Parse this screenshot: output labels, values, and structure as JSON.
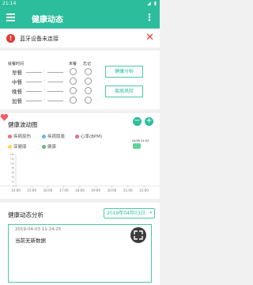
{
  "status_bar": {
    "time": "21:14",
    "icons_text": "◢ ▮"
  },
  "app_bar": {
    "title": "健康动态",
    "more": "⋮"
  },
  "alert": {
    "text": "蓝牙设备未连接",
    "close": "✕"
  },
  "meals": {
    "headers": {
      "time": "就餐时间",
      "skipped": "未餐",
      "forgot": "忘记"
    },
    "rows": [
      {
        "label": "早餐",
        "dash": "-"
      },
      {
        "label": "中餐",
        "dash": "-"
      },
      {
        "label": "晚餐",
        "dash": "-"
      },
      {
        "label": "加餐",
        "dash": "-"
      }
    ],
    "buttons": {
      "analysis": "健康分析",
      "risk": "疾病风险"
    }
  },
  "wave": {
    "title": "健康波动图",
    "zoom_out": "−",
    "zoom_in": "+",
    "legend": [
      {
        "label": "疾病捉伤",
        "color": "#e57373"
      },
      {
        "label": "疾病隐患",
        "color": "#64b5f6"
      },
      {
        "label": "心率(BPM)",
        "color": "#f06292"
      },
      {
        "label": "亚健康",
        "color": "#ffd54f"
      },
      {
        "label": "健康",
        "color": "#66bb6a"
      }
    ],
    "marker_stamp": "04/09 21:03"
  },
  "chart_data": {
    "type": "line",
    "x": [
      "14:00",
      "15:00",
      "16:00",
      "17:00",
      "18:00",
      "19:00",
      "20:00",
      "21:00",
      "22:00"
    ],
    "y_ticks": [
      "140",
      "120",
      "100",
      "80",
      "60",
      "40",
      "20",
      "0"
    ],
    "series": []
  },
  "analysis": {
    "title": "健康动态分析",
    "date": "2019年04月03日",
    "date_caret": "▾",
    "timestamp": "2019-04-03 11:24:25",
    "message": "当前无新数据"
  },
  "colors": {
    "accent": "#2bbd9c",
    "danger": "#e53935"
  }
}
